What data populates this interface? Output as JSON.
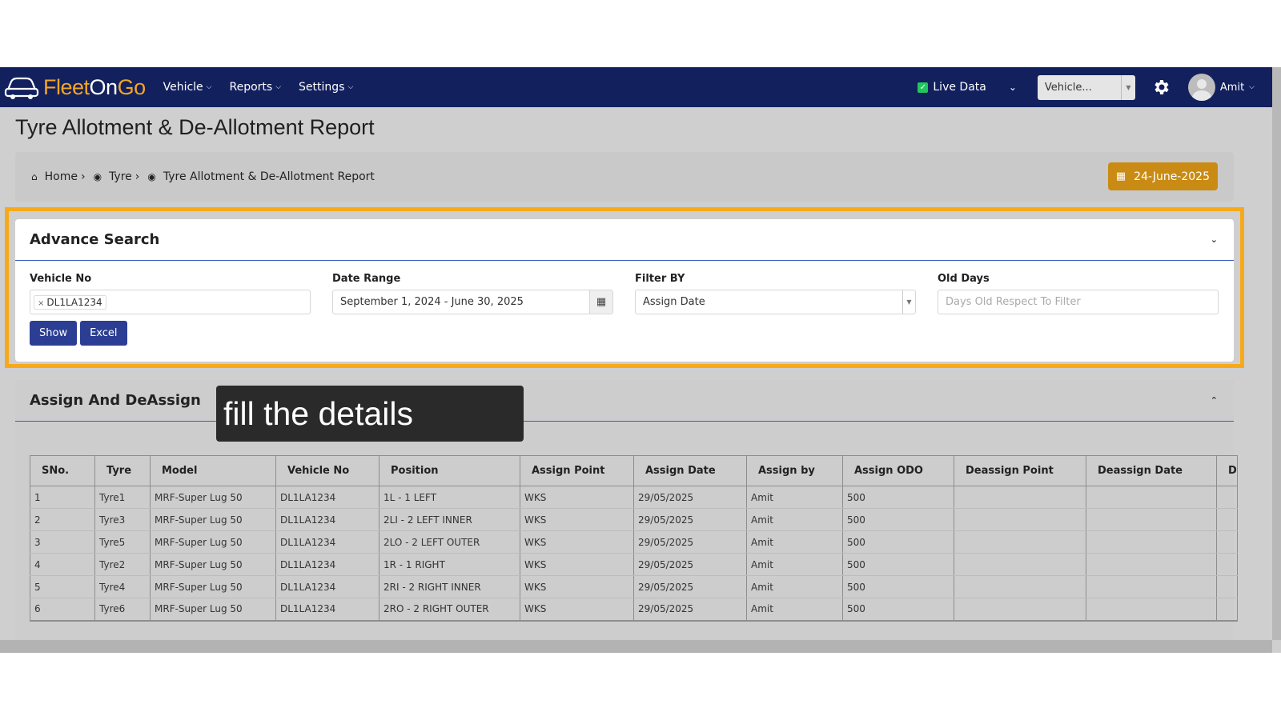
{
  "nav": {
    "logo_part1": "Fleet",
    "logo_part2": "On",
    "logo_part3": "Go",
    "menu": [
      "Vehicle",
      "Reports",
      "Settings"
    ],
    "live_data_label": "Live Data",
    "vehicle_select": "Vehicle...",
    "user_name": "Amit",
    "brand_color": "#12205e",
    "accent_color": "#f5a623"
  },
  "page": {
    "title": "Tyre Allotment & De-Allotment Report",
    "breadcrumb": [
      "Home",
      "Tyre",
      "Tyre Allotment & De-Allotment Report"
    ],
    "date_pill": "24-June-2025"
  },
  "search": {
    "title": "Advance Search",
    "vehicle_no_label": "Vehicle No",
    "vehicle_no_tag": "DL1LA1234",
    "date_range_label": "Date Range",
    "date_range_value": "September 1, 2024 - June 30, 2025",
    "filter_by_label": "Filter BY",
    "filter_by_value": "Assign Date",
    "old_days_label": "Old Days",
    "old_days_placeholder": "Days Old Respect To Filter",
    "show_button": "Show",
    "excel_button": "Excel"
  },
  "results": {
    "title": "Assign And DeAssign",
    "tooltip": "fill the details",
    "columns": [
      "SNo.",
      "Tyre",
      "Model",
      "Vehicle No",
      "Position",
      "Assign Point",
      "Assign Date",
      "Assign by",
      "Assign ODO",
      "Deassign Point",
      "Deassign Date",
      "D"
    ],
    "rows": [
      [
        "1",
        "Tyre1",
        "MRF-Super Lug 50",
        "DL1LA1234",
        "1L - 1 LEFT",
        "WKS",
        "29/05/2025",
        "Amit",
        "500",
        "",
        "",
        ""
      ],
      [
        "2",
        "Tyre3",
        "MRF-Super Lug 50",
        "DL1LA1234",
        "2LI - 2 LEFT INNER",
        "WKS",
        "29/05/2025",
        "Amit",
        "500",
        "",
        "",
        ""
      ],
      [
        "3",
        "Tyre5",
        "MRF-Super Lug 50",
        "DL1LA1234",
        "2LO - 2 LEFT OUTER",
        "WKS",
        "29/05/2025",
        "Amit",
        "500",
        "",
        "",
        ""
      ],
      [
        "4",
        "Tyre2",
        "MRF-Super Lug 50",
        "DL1LA1234",
        "1R - 1 RIGHT",
        "WKS",
        "29/05/2025",
        "Amit",
        "500",
        "",
        "",
        ""
      ],
      [
        "5",
        "Tyre4",
        "MRF-Super Lug 50",
        "DL1LA1234",
        "2RI - 2 RIGHT INNER",
        "WKS",
        "29/05/2025",
        "Amit",
        "500",
        "",
        "",
        ""
      ],
      [
        "6",
        "Tyre6",
        "MRF-Super Lug 50",
        "DL1LA1234",
        "2RO - 2 RIGHT OUTER",
        "WKS",
        "29/05/2025",
        "Amit",
        "500",
        "",
        "",
        ""
      ]
    ]
  },
  "highlight_color": "#f7a91a"
}
